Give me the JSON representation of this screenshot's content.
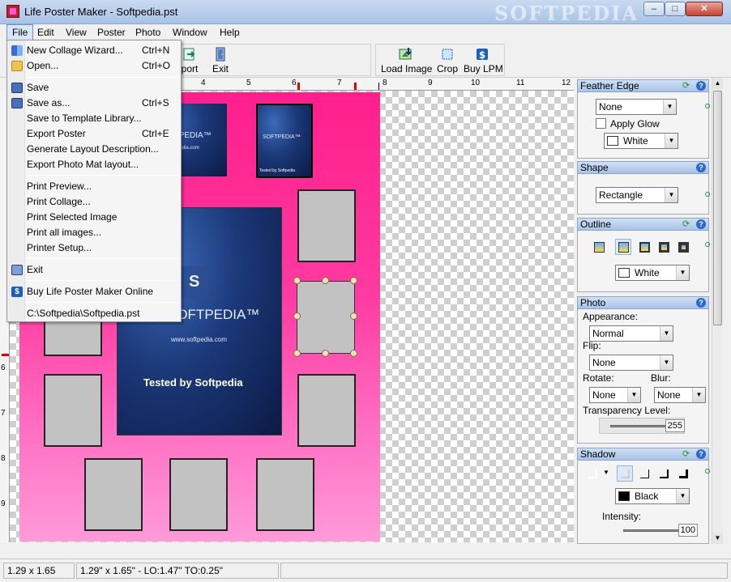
{
  "window": {
    "title": "Life Poster Maker - Softpedia.pst",
    "watermark": "SOFTPEDIA",
    "minimize": "–",
    "maximize": "□",
    "close": "✕"
  },
  "menubar": [
    "File",
    "Edit",
    "View",
    "Poster",
    "Photo",
    "Window",
    "Help"
  ],
  "toolbar": {
    "partial_label": "port",
    "exit": "Exit",
    "load_image": "Load Image",
    "crop": "Crop",
    "buy_lpm": "Buy LPM"
  },
  "ruler": {
    "top": [
      "4",
      "5",
      "6",
      "7",
      "8",
      "9",
      "10",
      "11",
      "12"
    ],
    "left": [
      "6",
      "7",
      "8",
      "9"
    ]
  },
  "file_menu": {
    "items": [
      {
        "label": "New Collage Wizard...",
        "shortcut": "Ctrl+N",
        "icon": "wizard-icon"
      },
      {
        "label": "Open...",
        "shortcut": "Ctrl+O",
        "icon": "folder-open-icon"
      },
      {
        "label": "Save",
        "shortcut": "",
        "icon": "floppy-icon"
      },
      {
        "label": "Save as...",
        "shortcut": "Ctrl+S",
        "icon": "floppy-as-icon"
      },
      {
        "label": "Save to Template Library...",
        "shortcut": "",
        "icon": ""
      },
      {
        "label": "Export Poster",
        "shortcut": "Ctrl+E",
        "icon": ""
      },
      {
        "label": "Generate Layout Description...",
        "shortcut": "",
        "icon": ""
      },
      {
        "label": "Export Photo Mat layout...",
        "shortcut": "",
        "icon": ""
      },
      {
        "label": "Print Preview...",
        "shortcut": "",
        "icon": ""
      },
      {
        "label": "Print Collage...",
        "shortcut": "",
        "icon": ""
      },
      {
        "label": "Print Selected Image",
        "shortcut": "",
        "icon": ""
      },
      {
        "label": "Print all images...",
        "shortcut": "",
        "icon": ""
      },
      {
        "label": "Printer Setup...",
        "shortcut": "",
        "icon": ""
      },
      {
        "label": "Exit",
        "shortcut": "",
        "icon": "exit-door-icon"
      },
      {
        "label": "Buy Life Poster Maker Online",
        "shortcut": "",
        "icon": "dollar-icon"
      },
      {
        "label": "C:\\Softpedia\\Softpedia.pst",
        "shortcut": "",
        "icon": ""
      }
    ]
  },
  "poster": {
    "small_photo1": {
      "brand": "SOFTPEDIA™",
      "url": "www.softpedia.com"
    },
    "small_photo2": {
      "brand": "SOFTPEDIA™",
      "caption": "Tested by Softpedia"
    },
    "big_photo": {
      "letter": "S",
      "brand": "SOFTPEDIA™",
      "url": "www.softpedia.com",
      "caption": "Tested by Softpedia"
    },
    "background_top": "#ff1f8c",
    "background_bottom": "#ff9ad8"
  },
  "panel": {
    "feather_edge": {
      "title": "Feather Edge",
      "value": "None",
      "apply_glow": "Apply Glow",
      "color": "White",
      "color_hex": "#ffffff"
    },
    "shape": {
      "title": "Shape",
      "value": "Rectangle"
    },
    "outline": {
      "title": "Outline",
      "color": "White",
      "color_hex": "#ffffff"
    },
    "photo": {
      "title": "Photo",
      "appearance_label": "Appearance:",
      "appearance": "Normal",
      "flip_label": "Flip:",
      "flip": "None",
      "rotate_label": "Rotate:",
      "rotate": "None",
      "blur_label": "Blur:",
      "blur": "None",
      "transparency_label": "Transparency Level:",
      "transparency": "255",
      "transparency_level": 1.0
    },
    "shadow": {
      "title": "Shadow",
      "color": "Black",
      "color_hex": "#000000",
      "intensity_label": "Intensity:",
      "intensity": "100",
      "intensity_level": 1.0
    }
  },
  "status": {
    "size": "1.29 x 1.65",
    "details": "1.29\" x 1.65\" - LO:1.47\" TO:0.25\""
  }
}
